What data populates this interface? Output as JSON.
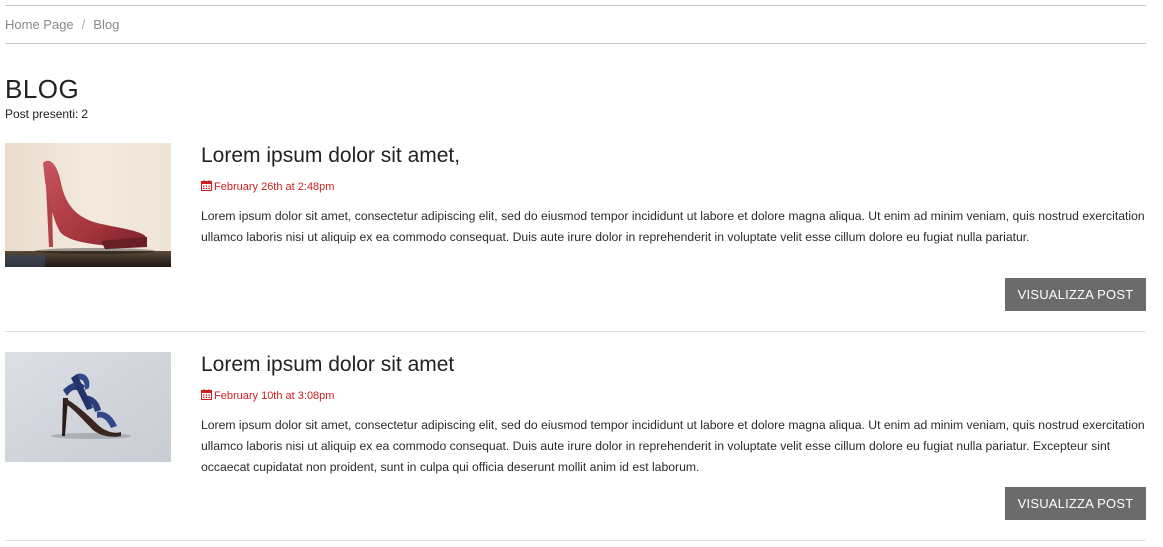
{
  "breadcrumb": {
    "home": "Home Page",
    "separator": "/",
    "current": "Blog"
  },
  "page": {
    "title": "BLOG",
    "count_label": "Post presenti:",
    "count_value": "2"
  },
  "colors": {
    "date_red": "#cc1f1f",
    "button_bg": "#6b6b6b"
  },
  "posts": [
    {
      "title": "Lorem ipsum dolor sit amet,",
      "date": "February 26th at 2:48pm",
      "date_icon": "calendar-icon",
      "image": "red-high-heel-shoe",
      "excerpt": "Lorem ipsum dolor sit amet, consectetur adipiscing elit, sed do eiusmod tempor incididunt ut labore et dolore magna aliqua. Ut enim ad minim veniam, quis nostrud exercitation ullamco laboris nisi ut aliquip ex ea commodo consequat. Duis aute irure dolor in reprehenderit in voluptate velit esse cillum dolore eu fugiat nulla pariatur.",
      "button": "VISUALIZZA POST"
    },
    {
      "title": "Lorem ipsum dolor sit amet",
      "date": "February 10th at 3:08pm",
      "date_icon": "calendar-icon",
      "image": "blue-strappy-heel-shoe",
      "excerpt": "Lorem ipsum dolor sit amet, consectetur adipiscing elit, sed do eiusmod tempor incididunt ut labore et dolore magna aliqua. Ut enim ad minim veniam, quis nostrud exercitation ullamco laboris nisi ut aliquip ex ea commodo consequat. Duis aute irure dolor in reprehenderit in voluptate velit esse cillum dolore eu fugiat nulla pariatur. Excepteur sint occaecat cupidatat non proident, sunt in culpa qui officia deserunt mollit anim id est laborum.",
      "button": "VISUALIZZA POST"
    }
  ]
}
